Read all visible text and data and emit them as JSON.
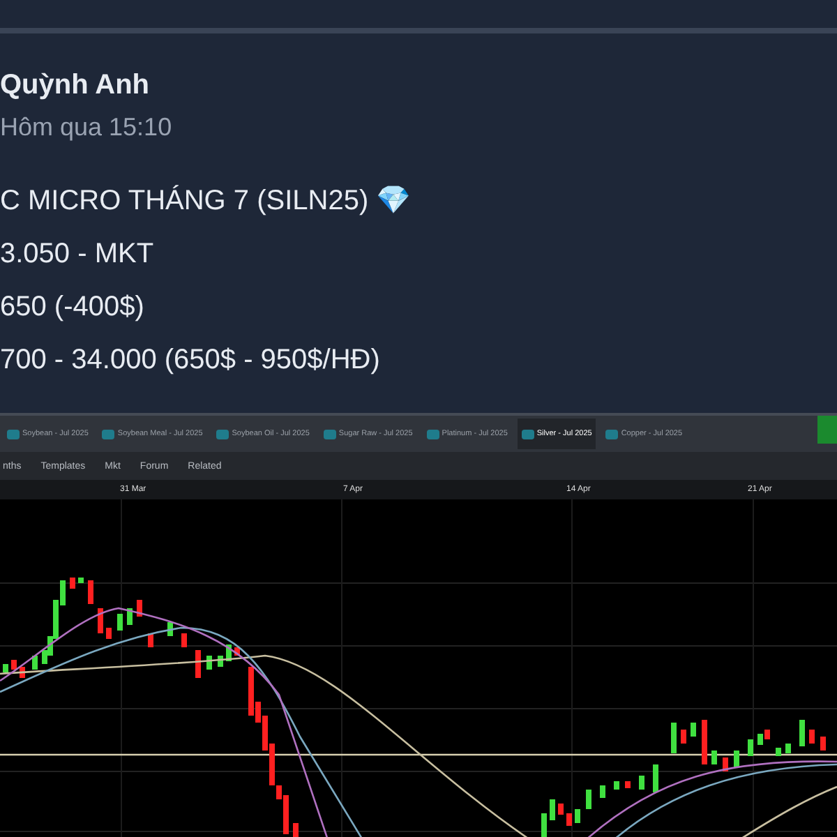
{
  "post": {
    "author": "Quỳnh Anh",
    "time": "Hôm qua 15:10",
    "lines": [
      "C MICRO THÁNG 7 (SILN25) 💎",
      "3.050 - MKT",
      "650 (-400$)",
      "700 - 34.000 (650$ - 950$/HĐ)"
    ]
  },
  "screenshot": {
    "tabs": [
      {
        "label": "Soybean - Jul 2025",
        "selected": false
      },
      {
        "label": "Soybean Meal - Jul 2025",
        "selected": false
      },
      {
        "label": "Soybean Oil - Jul 2025",
        "selected": false
      },
      {
        "label": "Sugar Raw - Jul 2025",
        "selected": false
      },
      {
        "label": "Platinum - Jul 2025",
        "selected": false
      },
      {
        "label": "Silver - Jul 2025",
        "selected": true
      },
      {
        "label": "Copper - Jul 2025",
        "selected": false
      }
    ],
    "toolbar": [
      "nths",
      "Templates",
      "Mkt",
      "Forum",
      "Related"
    ],
    "dates": [
      "31 Mar",
      "7 Apr",
      "14 Apr",
      "21 Apr"
    ]
  }
}
